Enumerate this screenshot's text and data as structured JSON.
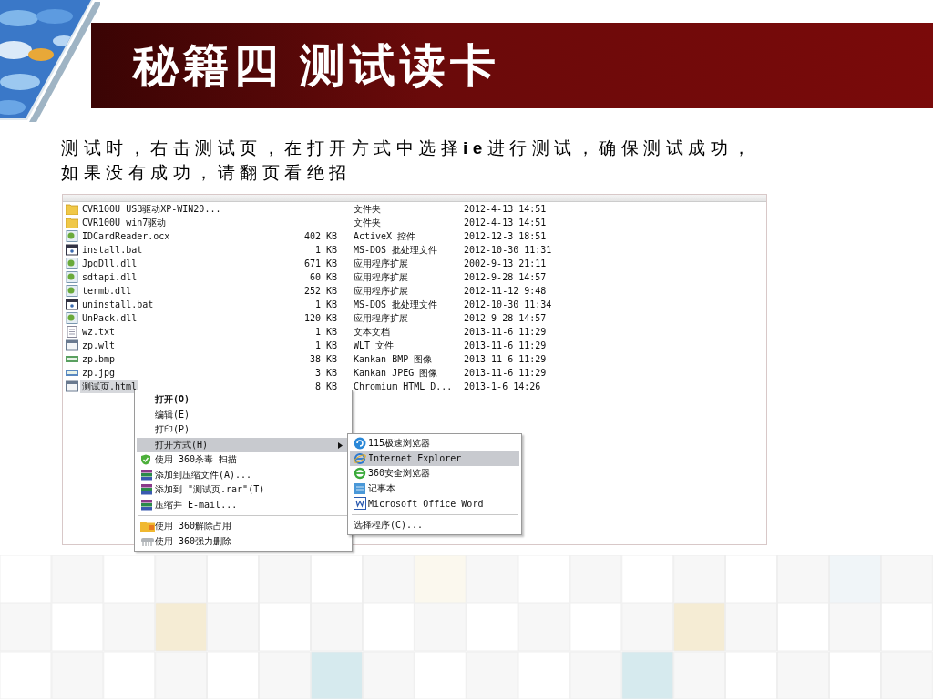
{
  "slide": {
    "title": "秘籍四 测试读卡",
    "body": "测试时，右击测试页，在打开方式中选择**ie**进行测试，确保测试成功，如果没有成功，请翻页看绝招"
  },
  "explorer": {
    "files": [
      {
        "name": "CVR100U USB驱动XP-WIN20...",
        "type": "文件夹",
        "modified": "2012-4-13 14:51",
        "kind": "folder",
        "selected": false
      },
      {
        "name": "CVR100U win7驱动",
        "type": "文件夹",
        "modified": "2012-4-13 14:51",
        "kind": "folder",
        "selected": false
      },
      {
        "name": "IDCardReader.ocx",
        "size": "402 KB",
        "type": "ActiveX 控件",
        "modified": "2012-12-3 18:51",
        "kind": "dll",
        "selected": false
      },
      {
        "name": "install.bat",
        "size": "1 KB",
        "type": "MS-DOS 批处理文件",
        "modified": "2012-10-30 11:31",
        "kind": "bat",
        "selected": false
      },
      {
        "name": "JpgDll.dll",
        "size": "671 KB",
        "type": "应用程序扩展",
        "modified": "2002-9-13 21:11",
        "kind": "dll",
        "selected": false
      },
      {
        "name": "sdtapi.dll",
        "size": "60 KB",
        "type": "应用程序扩展",
        "modified": "2012-9-28 14:57",
        "kind": "dll",
        "selected": false
      },
      {
        "name": "termb.dll",
        "size": "252 KB",
        "type": "应用程序扩展",
        "modified": "2012-11-12 9:48",
        "kind": "dll",
        "selected": false
      },
      {
        "name": "uninstall.bat",
        "size": "1 KB",
        "type": "MS-DOS 批处理文件",
        "modified": "2012-10-30 11:34",
        "kind": "bat",
        "selected": false
      },
      {
        "name": "UnPack.dll",
        "size": "120 KB",
        "type": "应用程序扩展",
        "modified": "2012-9-28 14:57",
        "kind": "dll",
        "selected": false
      },
      {
        "name": "wz.txt",
        "size": "1 KB",
        "type": "文本文档",
        "modified": "2013-11-6 11:29",
        "kind": "txt",
        "selected": false
      },
      {
        "name": "zp.wlt",
        "size": "1 KB",
        "type": "WLT 文件",
        "modified": "2013-11-6 11:29",
        "kind": "wlt",
        "selected": false
      },
      {
        "name": "zp.bmp",
        "size": "38 KB",
        "type": "Kankan BMP 图像",
        "modified": "2013-11-6 11:29",
        "kind": "bmp",
        "selected": false
      },
      {
        "name": "zp.jpg",
        "size": "3 KB",
        "type": "Kankan JPEG 图像",
        "modified": "2013-11-6 11:29",
        "kind": "jpg",
        "selected": false
      },
      {
        "name": "测试页.html",
        "size": "8 KB",
        "type": "Chromium HTML D...",
        "modified": "2013-1-6 14:26",
        "kind": "html",
        "selected": true
      }
    ],
    "context_menu": {
      "groups": [
        [
          {
            "label": "打开(O)",
            "default": true,
            "selected": false,
            "submenu": false
          },
          {
            "label": "编辑(E)",
            "default": false,
            "selected": false,
            "submenu": false
          },
          {
            "label": "打印(P)",
            "default": false,
            "selected": false,
            "submenu": false
          },
          {
            "label": "打开方式(H)",
            "default": false,
            "selected": true,
            "submenu": true
          },
          {
            "label": "使用 360杀毒 扫描",
            "kind": "shield",
            "default": false,
            "selected": false,
            "submenu": false
          },
          {
            "label": "添加到压缩文件(A)...",
            "kind": "archive",
            "default": false,
            "selected": false,
            "submenu": false
          },
          {
            "label": "添加到 \"测试页.rar\"(T)",
            "kind": "archive",
            "default": false,
            "selected": false,
            "submenu": false
          },
          {
            "label": "压缩并 E-mail...",
            "kind": "archive",
            "default": false,
            "selected": false,
            "submenu": false
          }
        ],
        [
          {
            "label": "使用 360解除占用",
            "kind": "folder",
            "default": false,
            "selected": false,
            "submenu": false
          },
          {
            "label": "使用 360强力删除",
            "kind": "shredder",
            "default": false,
            "selected": false,
            "submenu": false
          }
        ]
      ]
    },
    "open_with_menu": {
      "groups": [
        [
          {
            "label": "115极速浏览器",
            "kind": "swirl",
            "selected": false
          },
          {
            "label": "Internet Explorer",
            "kind": "ie",
            "selected": true
          },
          {
            "label": "360安全浏览器",
            "kind": "green-e",
            "selected": false
          },
          {
            "label": "记事本",
            "kind": "notepad",
            "selected": false
          },
          {
            "label": "Microsoft Office Word",
            "kind": "word",
            "selected": false
          }
        ],
        [
          {
            "label": "选择程序(C)...",
            "selected": false
          }
        ]
      ]
    }
  }
}
